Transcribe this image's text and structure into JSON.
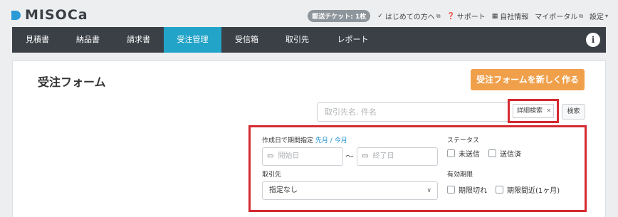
{
  "app": {
    "logo": "MISOCa"
  },
  "toplinks": {
    "badge": "郵送チケット: 1枚",
    "items": [
      {
        "icon": "✓",
        "label": "はじめての方へ",
        "external": "⧉"
      },
      {
        "icon": "❓",
        "label": "サポート",
        "external": ""
      },
      {
        "icon": "▦",
        "label": "自社情報",
        "external": ""
      },
      {
        "icon": "",
        "label": "マイポータル",
        "external": "⧉"
      },
      {
        "icon": "",
        "label": "設定",
        "external": "▾"
      }
    ]
  },
  "nav": {
    "items": [
      "見積書",
      "納品書",
      "請求書",
      "受注管理",
      "受信箱",
      "取引先",
      "レポート"
    ],
    "active": "受注管理",
    "info_icon": "i"
  },
  "main": {
    "title": "受注フォーム",
    "new_button": "受注フォームを新しく作る",
    "search_placeholder": "取引先名, 件名",
    "detail_tag": "詳細検索",
    "detail_tag_close": "×",
    "search_button": "検索"
  },
  "filters": {
    "period_label": "作成日で期間指定",
    "last_month": "先月",
    "separator": "/",
    "this_month": "今月",
    "start_placeholder": "開始日",
    "range_sep": "〜",
    "end_placeholder": "終了日",
    "status_label": "ステータス",
    "status_unsent": "未送信",
    "status_sent": "送信済",
    "partner_label": "取引先",
    "partner_value": "指定なし",
    "expiry_label": "有効期限",
    "expired": "期限切れ",
    "expiring": "期限間近(1ヶ月)"
  },
  "colors": {
    "accent": "#22a3c8",
    "nav_bg": "#3b4047",
    "primary_button": "#f0a04b",
    "highlight": "#d42a31"
  }
}
